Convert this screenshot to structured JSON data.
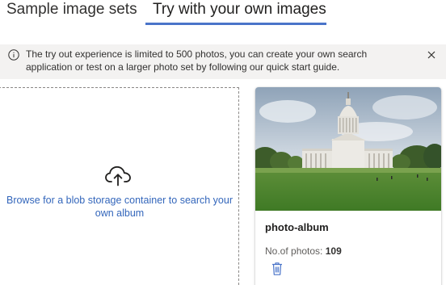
{
  "tabs": [
    {
      "label": "Sample image sets",
      "selected": false
    },
    {
      "label": "Try with your own images",
      "selected": true
    }
  ],
  "info_bar": {
    "icon": "info-icon",
    "text": "The try out experience is limited to 500 photos, you can create your own search application or test on a larger photo set by following our quick start guide.",
    "close_icon": "close-icon"
  },
  "upload": {
    "icon": "cloud-upload-icon",
    "text": "Browse for a blob storage container to search your own album"
  },
  "album_card": {
    "title": "photo-album",
    "count_label": "No.of photos:",
    "count_value": "109",
    "delete_icon": "trash-icon"
  },
  "colors": {
    "accent": "#4a74c9",
    "link": "#3366bb",
    "info_bg": "#f3f2f1"
  }
}
